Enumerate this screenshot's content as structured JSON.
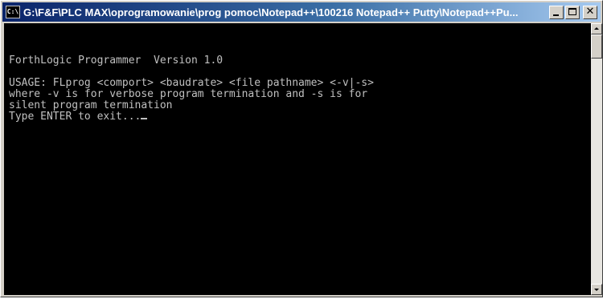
{
  "window": {
    "title": "G:\\F&F\\PLC MAX\\oprogramowanie\\prog pomoc\\Notepad++\\100216 Notepad++ Putty\\Notepad++Pu...",
    "icon": "console-icon",
    "icon_label": "C:\\",
    "controls": {
      "minimize_icon": "minimize-icon",
      "maximize_icon": "maximize-icon",
      "close_icon": "close-icon",
      "close_glyph": "✕"
    }
  },
  "console": {
    "lines": [
      "ForthLogic Programmer  Version 1.0",
      "",
      "USAGE: FLprog <comport> <baudrate> <file pathname> <-v|-s>",
      "where -v is for verbose program termination and -s is for",
      "silent program termination",
      "Type ENTER to exit..."
    ],
    "text_color": "#c0c0c0",
    "background_color": "#000000"
  },
  "scrollbar": {
    "up_icon": "scroll-up-arrow-icon",
    "down_icon": "scroll-down-arrow-icon"
  }
}
